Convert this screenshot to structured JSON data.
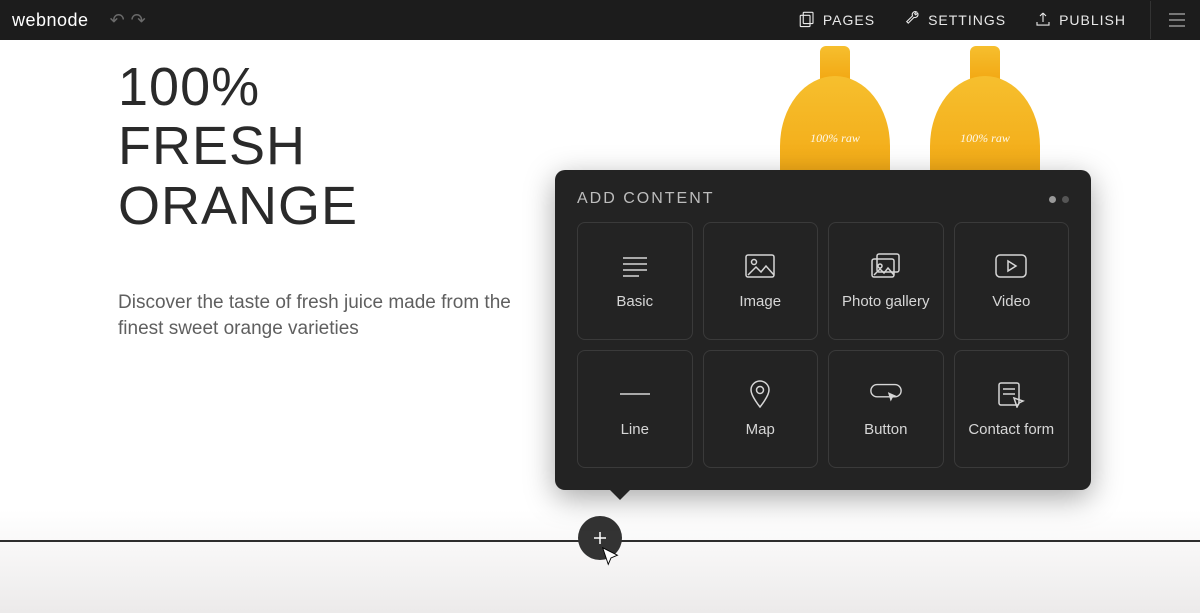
{
  "topbar": {
    "logo": "webnode",
    "pages": "PAGES",
    "settings": "SETTINGS",
    "publish": "PUBLISH"
  },
  "hero": {
    "title": "100%\nFRESH\nORANGE",
    "subtitle": "Discover the taste of fresh juice made from the finest sweet orange varieties",
    "bottle_label": "100% raw"
  },
  "popover": {
    "title": "ADD CONTENT",
    "tiles": [
      {
        "label": "Basic"
      },
      {
        "label": "Image"
      },
      {
        "label": "Photo gallery"
      },
      {
        "label": "Video"
      },
      {
        "label": "Line"
      },
      {
        "label": "Map"
      },
      {
        "label": "Button"
      },
      {
        "label": "Contact form"
      }
    ]
  }
}
